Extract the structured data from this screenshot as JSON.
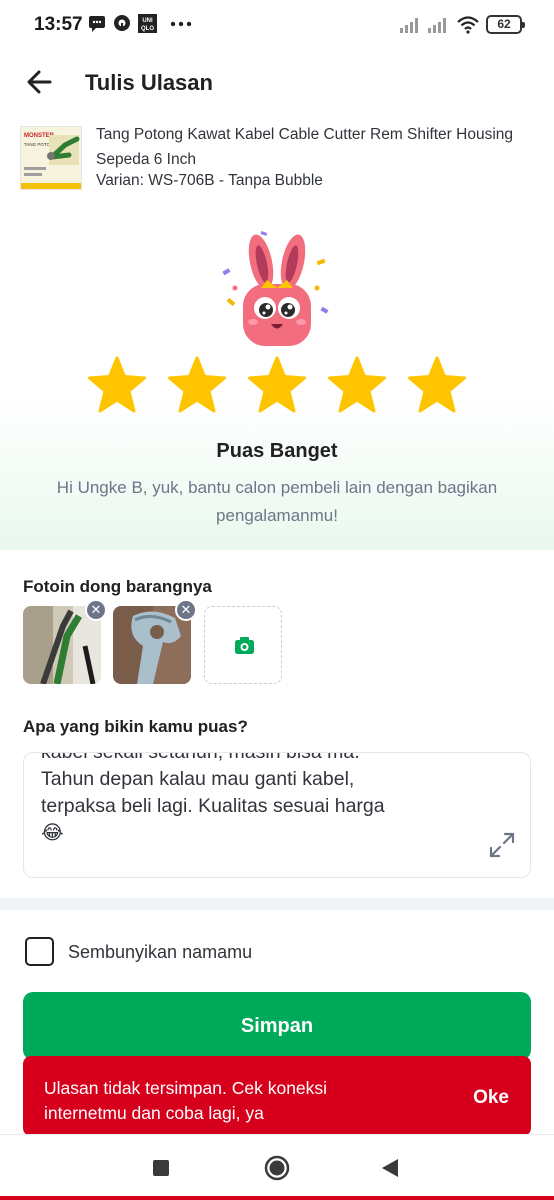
{
  "status_bar": {
    "time": "13:57",
    "icons": [
      "message-icon",
      "drive-icon",
      "uniqlo-icon",
      "more-dots-icon"
    ],
    "battery": "62"
  },
  "header": {
    "title": "Tulis Ulasan",
    "back_icon": "arrow-left-icon"
  },
  "product": {
    "name": "Tang Potong Kawat Kabel Cable Cutter Rem Shifter Housing Sepeda 6 Inch",
    "variant": "Varian: WS-706B - Tanpa Bubble",
    "thumb_brand": "MONSTER",
    "thumb_text": "TANG POTONG KAWAT"
  },
  "rating": {
    "stars": 5,
    "max_stars": 5,
    "star_color": "#ffc400",
    "label": "Puas Banget",
    "subtitle": "Hi Ungke B, yuk, bantu calon pembeli lain dengan bagikan pengalamanmu!"
  },
  "photos": {
    "title": "Fotoin dong barangnya",
    "remove_symbol": "✕",
    "add_icon": "camera-icon"
  },
  "review": {
    "title": "Apa yang bikin kamu puas?",
    "text": "kabel sekali setahun, masih bisa ma.\nTahun depan kalau mau ganti kabel,\nterpaksa beli lagi. Kualitas sesuai harga\n😂",
    "expand_icon": "expand-icon"
  },
  "anonymous": {
    "label": "Sembunyikan namamu",
    "checked": false
  },
  "save_button": {
    "label": "Simpan",
    "color": "#00aa5b"
  },
  "toast": {
    "message": "Ulasan tidak tersimpan. Cek koneksi internetmu dan coba lagi, ya",
    "action": "Oke",
    "color": "#d6001c"
  },
  "navbar": {
    "icons": [
      "recent-apps-icon",
      "home-icon",
      "back-triangle-icon"
    ]
  }
}
